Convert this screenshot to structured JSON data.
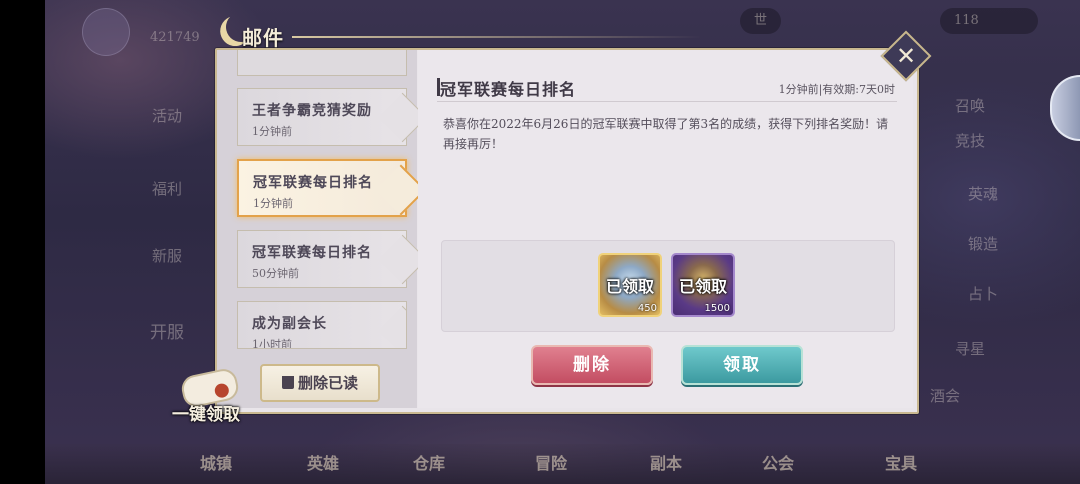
{
  "window_title": "邮件",
  "close_icon": "close-icon",
  "mail_list": [
    {
      "name": "王者争霸竞猜奖励",
      "time": "1分钟前",
      "selected": false
    },
    {
      "name": "冠军联赛每日排名",
      "time": "1分钟前",
      "selected": true
    },
    {
      "name": "冠军联赛每日排名",
      "time": "50分钟前",
      "selected": false
    },
    {
      "name": "成为副会长",
      "time": "1小时前",
      "selected": false
    }
  ],
  "delete_read_label": "删除已读",
  "one_click_label": "一键领取",
  "detail": {
    "title": "冠军联赛每日排名",
    "meta": "1分钟前|有效期:7天0时",
    "body": "恭喜你在2022年6月26日的冠军联赛中取得了第3名的成绩，获得下列排名奖励！请再接再厉！",
    "rewards": [
      {
        "status": "已领取",
        "count": "450",
        "icon": "diamond-icon"
      },
      {
        "status": "已领取",
        "count": "1500",
        "icon": "emblem-icon"
      }
    ],
    "delete_label": "删除",
    "claim_label": "领取"
  },
  "background": {
    "top_value": "421749",
    "resources": [
      "世",
      "118"
    ],
    "left_menu": [
      "活动",
      "福利",
      "新服",
      "开服"
    ],
    "right_menu": [
      "召唤",
      "竞技",
      "英魂",
      "锻造",
      "占卜",
      "寻星",
      "酒会"
    ],
    "bottom_menu": [
      "城镇",
      "英雄",
      "仓库",
      "冒险",
      "副本",
      "公会",
      "宝具"
    ]
  },
  "colors": {
    "selected_border": "#e3a24a",
    "delete_button": "#c34d62",
    "claim_button": "#3c9aa0",
    "frame_gold": "#c9b890"
  }
}
